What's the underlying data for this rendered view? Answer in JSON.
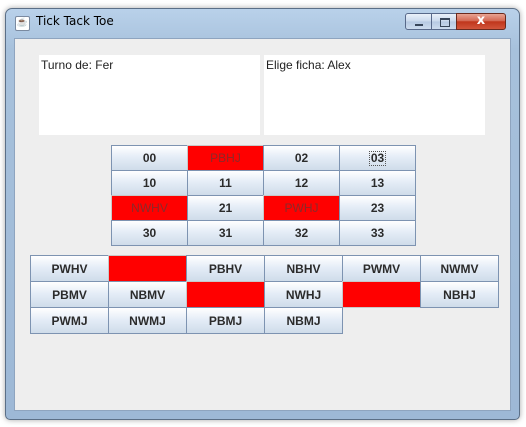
{
  "window": {
    "title": "Tick Tack Toe",
    "controls": {
      "close_label": "x"
    }
  },
  "panels": {
    "turn": "Turno de: Fer",
    "choose": "Elige ficha: Alex"
  },
  "board": {
    "rows": [
      [
        {
          "label": "00",
          "red": false
        },
        {
          "label": "PBHJ",
          "red": true
        },
        {
          "label": "02",
          "red": false
        },
        {
          "label": "03",
          "red": false,
          "focused": true
        }
      ],
      [
        {
          "label": "10",
          "red": false
        },
        {
          "label": "11",
          "red": false
        },
        {
          "label": "12",
          "red": false
        },
        {
          "label": "13",
          "red": false
        }
      ],
      [
        {
          "label": "NWHV",
          "red": true
        },
        {
          "label": "21",
          "red": false
        },
        {
          "label": "PWHJ",
          "red": true
        },
        {
          "label": "23",
          "red": false
        }
      ],
      [
        {
          "label": "30",
          "red": false
        },
        {
          "label": "31",
          "red": false
        },
        {
          "label": "32",
          "red": false
        },
        {
          "label": "33",
          "red": false
        }
      ]
    ]
  },
  "pieces": {
    "rows": [
      [
        {
          "label": "PWHV",
          "red": false
        },
        {
          "label": "",
          "red": true
        },
        {
          "label": "PBHV",
          "red": false
        },
        {
          "label": "NBHV",
          "red": false
        },
        {
          "label": "PWMV",
          "red": false
        },
        {
          "label": "NWMV",
          "red": false
        }
      ],
      [
        {
          "label": "PBMV",
          "red": false
        },
        {
          "label": "NBMV",
          "red": false
        },
        {
          "label": "",
          "red": true
        },
        {
          "label": "NWHJ",
          "red": false
        },
        {
          "label": "",
          "red": true
        },
        {
          "label": "NBHJ",
          "red": false
        }
      ],
      [
        {
          "label": "PWMJ",
          "red": false
        },
        {
          "label": "NWMJ",
          "red": false
        },
        {
          "label": "PBMJ",
          "red": false
        },
        {
          "label": "NBMJ",
          "red": false
        }
      ]
    ]
  },
  "colors": {
    "occupied": "#ff0000",
    "button_top": "#ffffff",
    "button_bottom": "#cfdcea",
    "window_frame": "#b9d1ea"
  }
}
